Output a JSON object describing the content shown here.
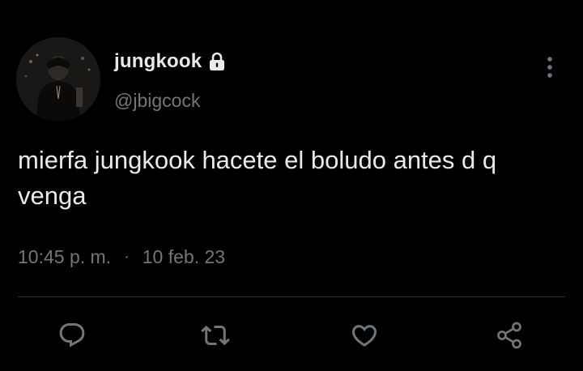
{
  "tweet": {
    "author": {
      "display_name": "jungkook",
      "handle": "@jbigcock",
      "protected_icon": "lock-icon",
      "avatar": "profile-photo"
    },
    "text": "mierfa jungkook hacete el boludo antes d q venga",
    "time": "10:45 p. m.",
    "separator": "·",
    "date": "10 feb. 23"
  },
  "actions": [
    {
      "name": "reply",
      "icon": "reply-icon"
    },
    {
      "name": "retweet",
      "icon": "retweet-icon"
    },
    {
      "name": "like",
      "icon": "heart-icon"
    },
    {
      "name": "share",
      "icon": "share-icon"
    }
  ],
  "colors": {
    "background": "#000000",
    "primary_text": "#e7e9ea",
    "secondary_text": "#71767b",
    "divider": "#2f3336"
  }
}
